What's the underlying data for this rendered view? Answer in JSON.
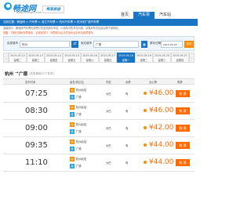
{
  "header": {
    "logo_text": "畅途网",
    "logo_url": "www.changtu.com",
    "slogan": "畅享旅途",
    "nav": [
      "首页",
      "汽车票",
      "汽车站"
    ]
  },
  "breadcrumb": "当前位置：畅途网 > 汽车票 > 浙江汽车票 > 杭州汽车票 > 杭州到广德汽车票",
  "notices": {
    "line1": "温馨提示：畅途网汽车票在线预订仅支持部分车站，以实际可售车次为准，请核对车次信息后再下单购买。",
    "line2": "提醒：节假日期间车票紧张，请提前预订，购票成功后请凭身份证到车站取票乘车。"
  },
  "search": {
    "from_label": "出发城市",
    "from_value": "杭州",
    "swap_icon": "⇄",
    "to_label": "到达城市",
    "to_value": "广德",
    "date_label": "乘车日期",
    "date_value": "2015-05-18",
    "query_button": "查询"
  },
  "dates": [
    {
      "date": "2015-05-12",
      "week": "星期二"
    },
    {
      "date": "2015-05-13",
      "week": "星期三"
    },
    {
      "date": "2015-05-14",
      "week": "星期四"
    },
    {
      "date": "2015-05-15",
      "week": "星期五"
    },
    {
      "date": "2015-05-16",
      "week": "星期六"
    },
    {
      "date": "2015-05-17",
      "week": "星期日"
    },
    {
      "date": "2015-05-18",
      "week": "星期一"
    },
    {
      "date": "2015-05-19",
      "week": "星期二"
    },
    {
      "date": "2015-05-20",
      "week": "星期三"
    },
    {
      "date": "2015-05-21",
      "week": "星期四"
    }
  ],
  "route": {
    "from": "杭州",
    "to": "广德",
    "count_text": "(共查询到12个车次)"
  },
  "table_headers": [
    "发车时间",
    "始发/到达站",
    "车型",
    "余票",
    "全价票",
    "购票"
  ],
  "trips": [
    {
      "time": "07:25",
      "start": "杭州北站",
      "end": "广德",
      "bus": "大巴",
      "seat": "有",
      "price": "¥46.00",
      "buy": "购 票"
    },
    {
      "time": "08:30",
      "start": "杭州北站",
      "end": "广德",
      "bus": "大巴",
      "seat": "有",
      "price": "¥46.00",
      "buy": "购 票"
    },
    {
      "time": "09:00",
      "start": "杭州北站",
      "end": "广德",
      "bus": "中巴",
      "seat": "有",
      "price": "¥42.00",
      "buy": "购 票"
    },
    {
      "time": "09:35",
      "start": "杭州北站",
      "end": "广德",
      "bus": "大巴",
      "seat": "有",
      "price": "¥44.00",
      "buy": "购 票"
    },
    {
      "time": "11:10",
      "start": "杭州北站",
      "end": "广德",
      "bus": "大巴",
      "seat": "有",
      "price": "¥44.00",
      "buy": "购 票"
    }
  ],
  "badges": {
    "start": "始",
    "end": "终"
  }
}
